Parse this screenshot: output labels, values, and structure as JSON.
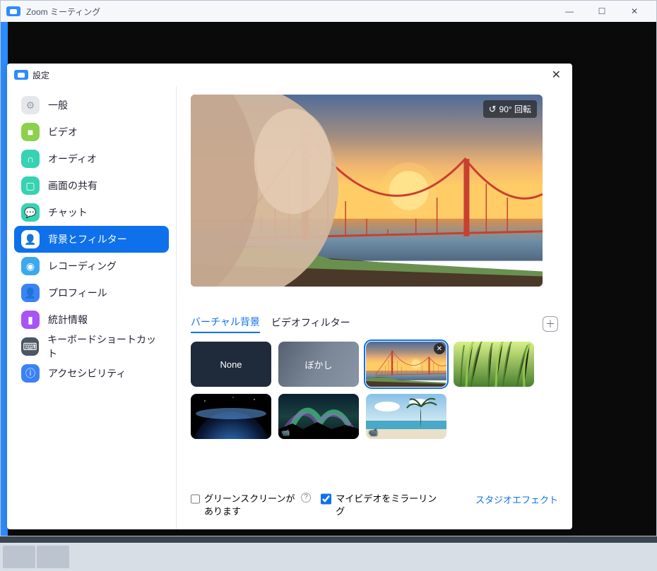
{
  "meeting": {
    "title": "Zoom ミーティング"
  },
  "settings": {
    "title": "設定",
    "rotate_label": "90° 回転",
    "sidebar": {
      "items": [
        {
          "label": "一般"
        },
        {
          "label": "ビデオ"
        },
        {
          "label": "オーディオ"
        },
        {
          "label": "画面の共有"
        },
        {
          "label": "チャット"
        },
        {
          "label": "背景とフィルター"
        },
        {
          "label": "レコーディング"
        },
        {
          "label": "プロフィール"
        },
        {
          "label": "統計情報"
        },
        {
          "label": "キーボードショートカット"
        },
        {
          "label": "アクセシビリティ"
        }
      ]
    },
    "tabs": {
      "virtual_bg": "バーチャル背景",
      "video_filters": "ビデオフィルター"
    },
    "backgrounds": {
      "none_label": "None",
      "blur_label": "ぼかし"
    },
    "footer": {
      "greenscreen_label": "グリーンスクリーンがあります",
      "mirror_label": "マイビデオをミラーリング",
      "studio_effects": "スタジオエフェクト"
    }
  }
}
